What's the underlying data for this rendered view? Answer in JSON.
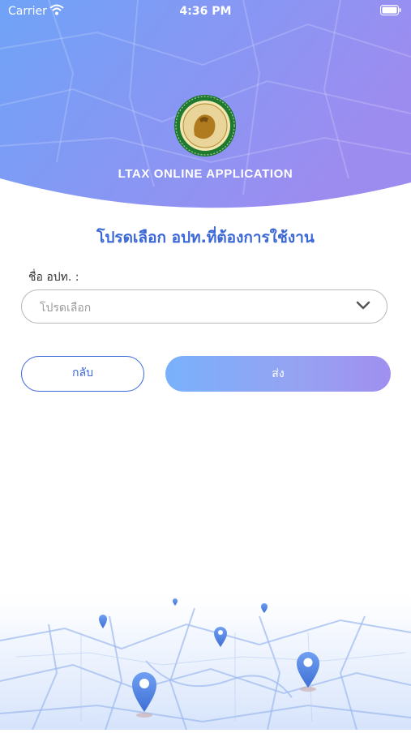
{
  "status_bar": {
    "carrier": "Carrier",
    "time": "4:36 PM"
  },
  "header": {
    "app_title": "LTAX ONLINE APPLICATION",
    "logo": "department-seal-emblem",
    "gradient": {
      "from": "#6fa3f7",
      "to": "#9d8cf0"
    }
  },
  "main": {
    "heading": "โปรดเลือก อปท.ที่ต้องการใช้งาน",
    "field_label": "ชื่อ อปท.  :",
    "select": {
      "value": "โปรดเลือก",
      "icon": "chevron-down-icon"
    },
    "back_label": "กลับ",
    "send_label": "ส่ง"
  },
  "colors": {
    "accent": "#3b68d6",
    "border": "#b8b8b8",
    "placeholder": "#9a9a9a"
  }
}
